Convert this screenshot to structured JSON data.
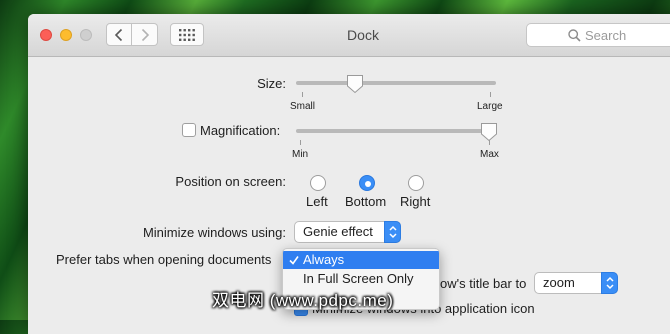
{
  "window": {
    "title": "Dock"
  },
  "search": {
    "placeholder": "Search"
  },
  "size": {
    "label": "Size:",
    "min_label": "Small",
    "max_label": "Large",
    "value_fraction": 0.28
  },
  "magnification": {
    "label": "Magnification:",
    "checked": false,
    "min_label": "Min",
    "max_label": "Max",
    "value_fraction": 1.0
  },
  "position": {
    "label": "Position on screen:",
    "options": [
      "Left",
      "Bottom",
      "Right"
    ],
    "selected": "Bottom"
  },
  "minimize": {
    "label": "Minimize windows using:",
    "value": "Genie effect"
  },
  "prefer_tabs": {
    "label": "Prefer tabs when opening documents",
    "menu": [
      {
        "label": "Always",
        "selected": true
      },
      {
        "label": "In Full Screen Only",
        "selected": false
      }
    ]
  },
  "double_click": {
    "label_fragment": "ow's title bar to",
    "value": "zoom"
  },
  "minimize_into_icon": {
    "label": "Minimize windows into application icon",
    "checked": true
  },
  "watermark": "双电网 (www.pdpc.me)",
  "colors": {
    "accent": "#3a8ef6",
    "menu_highlight": "#2f7ef0"
  },
  "icons": [
    "back-icon",
    "forward-icon",
    "grid-icon",
    "search-icon",
    "chevron-updown-icon",
    "checkmark-icon"
  ]
}
